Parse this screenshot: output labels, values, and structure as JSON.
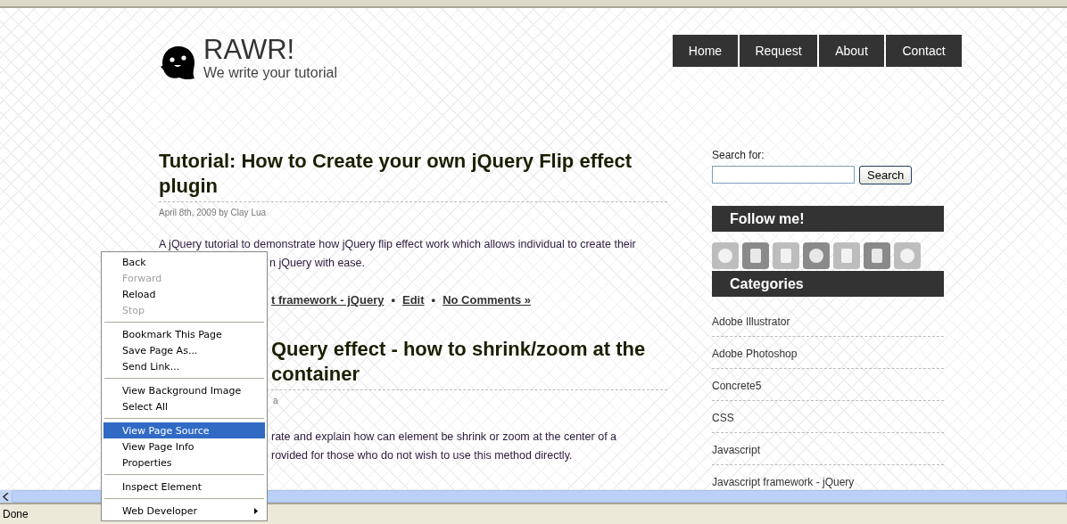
{
  "site": {
    "title": "RAWR!",
    "tagline": "We write your tutorial"
  },
  "nav": [
    {
      "label": "Home"
    },
    {
      "label": "Request"
    },
    {
      "label": "About"
    },
    {
      "label": "Contact"
    }
  ],
  "posts": [
    {
      "title": "Tutorial: How to Create your own jQuery Flip effect plugin",
      "meta": "April 8th, 2009 by Clay Lua",
      "excerpt": [
        "A jQuery tutorial to demonstrate how jQuery flip effect work which allows individual to create their",
        "n jQuery with ease."
      ],
      "links": [
        "t framework - jQuery",
        "Edit",
        "No Comments »"
      ],
      "link_separator": "•"
    },
    {
      "title": "Query effect - how to shrink/zoom at the",
      "title_2": "container",
      "meta": "a",
      "excerpt": [
        "rate and explain how can element be shrink or zoom at the center of a",
        "rovided for those who do not wish to use this method directly."
      ]
    }
  ],
  "sidebar": {
    "search_label": "Search for:",
    "search_button": "Search",
    "follow_heading": "Follow me!",
    "categories_heading": "Categories",
    "categories": [
      "Adobe Illustrator",
      "Adobe Photoshop",
      "Concrete5",
      "CSS",
      "Javascript",
      "Javascript framework - jQuery"
    ]
  },
  "context_menu": [
    {
      "kind": "item",
      "label": "Back",
      "disabled": false,
      "selected": false
    },
    {
      "kind": "item",
      "label": "Forward",
      "disabled": true,
      "selected": false
    },
    {
      "kind": "item",
      "label": "Reload",
      "disabled": false,
      "selected": false
    },
    {
      "kind": "item",
      "label": "Stop",
      "disabled": true,
      "selected": false
    },
    {
      "kind": "separator"
    },
    {
      "kind": "item",
      "label": "Bookmark This Page",
      "disabled": false,
      "selected": false
    },
    {
      "kind": "item",
      "label": "Save Page As...",
      "disabled": false,
      "selected": false
    },
    {
      "kind": "item",
      "label": "Send Link...",
      "disabled": false,
      "selected": false
    },
    {
      "kind": "separator"
    },
    {
      "kind": "item",
      "label": "View Background Image",
      "disabled": false,
      "selected": false
    },
    {
      "kind": "item",
      "label": "Select All",
      "disabled": false,
      "selected": false
    },
    {
      "kind": "separator"
    },
    {
      "kind": "item",
      "label": "View Page Source",
      "disabled": false,
      "selected": true
    },
    {
      "kind": "item",
      "label": "View Page Info",
      "disabled": false,
      "selected": false
    },
    {
      "kind": "item",
      "label": "Properties",
      "disabled": false,
      "selected": false
    },
    {
      "kind": "separator"
    },
    {
      "kind": "item",
      "label": "Inspect Element",
      "disabled": false,
      "selected": false
    },
    {
      "kind": "separator"
    },
    {
      "kind": "submenu",
      "label": "Web Developer",
      "disabled": false,
      "selected": false
    }
  ],
  "status_bar": {
    "text": "Done"
  }
}
